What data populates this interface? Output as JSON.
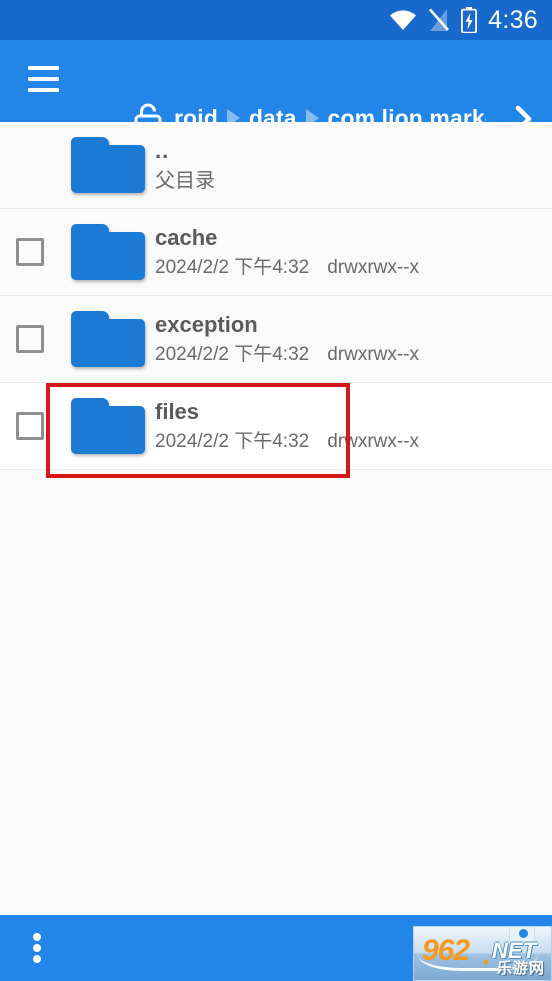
{
  "statusbar": {
    "time": "4:36",
    "icons": [
      "wifi-icon",
      "signal-off-icon",
      "battery-charging-icon"
    ]
  },
  "appbar": {
    "menu_icon": "hamburger-menu-icon",
    "lock_icon": "unlock-icon",
    "forward_icon": "chevron-right-icon",
    "breadcrumbs": [
      {
        "label": "roid"
      },
      {
        "label": "data"
      },
      {
        "label": "com.lion.market"
      }
    ],
    "scrollbar": {
      "thumb_percent": 22
    }
  },
  "list": {
    "rows": [
      {
        "name": "..",
        "subtitle": "父目录",
        "icon": "folder-icon",
        "has_checkbox": false,
        "highlighted": false,
        "date": "",
        "permissions": ""
      },
      {
        "name": "cache",
        "subtitle": "",
        "icon": "folder-icon",
        "has_checkbox": true,
        "highlighted": false,
        "date": "2024/2/2 下午4:32",
        "permissions": "drwxrwx--x"
      },
      {
        "name": "exception",
        "subtitle": "",
        "icon": "folder-icon",
        "has_checkbox": true,
        "highlighted": false,
        "date": "2024/2/2 下午4:32",
        "permissions": "drwxrwx--x"
      },
      {
        "name": "files",
        "subtitle": "",
        "icon": "folder-icon",
        "has_checkbox": true,
        "highlighted": true,
        "date": "2024/2/2 下午4:32",
        "permissions": "drwxrwx--x"
      }
    ]
  },
  "bottombar": {
    "overflow_icon": "overflow-menu-icon"
  },
  "watermark": {
    "number": "962",
    "dot": ".",
    "net": "NET",
    "chinese": "乐游网"
  },
  "colors": {
    "statusbar": "#1769ce",
    "appbar": "#2286e8",
    "folder": "#1a7ad4",
    "annotation": "#d41717",
    "list_bg": "#fafafa",
    "scrollbar_thumb": "#2cb7e2"
  }
}
